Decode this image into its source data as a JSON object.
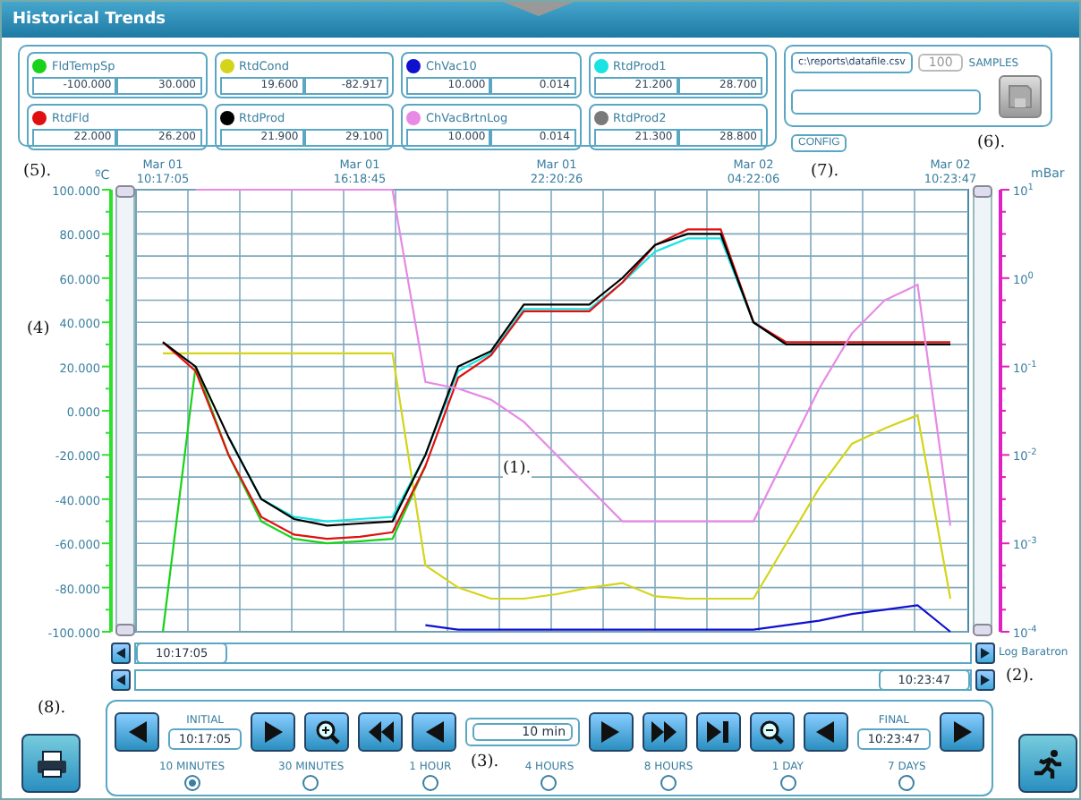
{
  "window": {
    "title": "Historical Trends"
  },
  "legend": [
    {
      "name": "FldTempSp",
      "color": "#19d219",
      "min": "-100.000",
      "max": "30.000"
    },
    {
      "name": "RtdCond",
      "color": "#d4d41a",
      "min": "19.600",
      "max": "-82.917"
    },
    {
      "name": "ChVac10",
      "color": "#1010d0",
      "min": "10.000",
      "max": "0.014"
    },
    {
      "name": "RtdProd1",
      "color": "#19e3e3",
      "min": "21.200",
      "max": "28.700"
    },
    {
      "name": "RtdFld",
      "color": "#e01010",
      "min": "22.000",
      "max": "26.200"
    },
    {
      "name": "RtdProd",
      "color": "#000000",
      "min": "21.900",
      "max": "29.100"
    },
    {
      "name": "ChVacBrtnLog",
      "color": "#e68ae6",
      "min": "10.000",
      "max": "0.014"
    },
    {
      "name": "RtdProd2",
      "color": "#7a7a7a",
      "min": "21.300",
      "max": "28.800"
    }
  ],
  "file_panel": {
    "path": "c:\\reports\\datafile.csv",
    "samples": {
      "value": "100",
      "label": "SAMPLES",
      "disabled": true
    },
    "save_button": {
      "disabled": true
    }
  },
  "config_button": "CONFIG",
  "annotations": [
    "(5).",
    "(7).",
    "(6).",
    "(4)",
    "(1).",
    "(2).",
    "(3).",
    "(8)."
  ],
  "chart": {
    "left_unit": "ºC",
    "right_unit": "mBar",
    "right_axis_name": "Log Baratron",
    "right_ticks": [
      {
        "base": "10",
        "exponent": "1"
      },
      {
        "base": "10",
        "exponent": "0"
      },
      {
        "base": "10",
        "exponent": "-1"
      },
      {
        "base": "10",
        "exponent": "-2"
      },
      {
        "base": "10",
        "exponent": "-3"
      },
      {
        "base": "10",
        "exponent": "-4"
      }
    ],
    "chart_data": {
      "type": "line",
      "categories": [
        "Mar 01 10:17:05",
        null,
        null,
        null,
        null,
        null,
        "Mar 01 16:18:45",
        null,
        null,
        null,
        null,
        null,
        "Mar 01 22:20:26",
        null,
        null,
        null,
        null,
        null,
        "Mar 02 04:22:06",
        null,
        null,
        null,
        null,
        null,
        "Mar 02 10:23:47"
      ],
      "ylim": [
        -100,
        100
      ],
      "grid": true,
      "yticks": [
        {
          "value": 100,
          "label": "100.000"
        },
        {
          "value": 80,
          "label": "80.000"
        },
        {
          "value": 60,
          "label": "60.000"
        },
        {
          "value": 40,
          "label": "40.000"
        },
        {
          "value": 20,
          "label": "20.000"
        },
        {
          "value": 0,
          "label": "0.000"
        },
        {
          "value": -20,
          "label": "-20.000"
        },
        {
          "value": -40,
          "label": "-40.000"
        },
        {
          "value": -60,
          "label": "-60.000"
        },
        {
          "value": -80,
          "label": "-80.000"
        },
        {
          "value": -100,
          "label": "-100.000"
        }
      ],
      "series": [
        {
          "color": "#19d219",
          "values": [
            -100,
            20,
            -20,
            -50,
            -58,
            -60,
            -59,
            -58,
            -25,
            null,
            null,
            null,
            null,
            null,
            null,
            null,
            null,
            null,
            null,
            null,
            null,
            null,
            null,
            null,
            null
          ]
        },
        {
          "color": "#d4d41a",
          "values": [
            26,
            26,
            26,
            26,
            26,
            26,
            26,
            26,
            -70,
            -80,
            -85,
            -85,
            -83,
            -80,
            -78,
            -84,
            -85,
            -85,
            -85,
            -60,
            -35,
            -15,
            -8,
            -2,
            -85
          ]
        },
        {
          "color": "#1010d0",
          "values": [
            null,
            null,
            null,
            null,
            null,
            null,
            null,
            null,
            -97,
            -99,
            -99,
            -99,
            -99,
            -99,
            -99,
            -99,
            -99,
            -99,
            -99,
            -97,
            -95,
            -92,
            -90,
            -88,
            -100
          ]
        },
        {
          "color": "#19e3e3",
          "values": [
            null,
            null,
            -12,
            -40,
            -48,
            -50,
            -49,
            -48,
            -20,
            18,
            26,
            46,
            46,
            46,
            58,
            72,
            78,
            78,
            40,
            30,
            null,
            null,
            null,
            null,
            null
          ]
        },
        {
          "color": "#e01010",
          "values": [
            31,
            18,
            -20,
            -48,
            -56,
            -58,
            -57,
            -55,
            -25,
            15,
            25,
            45,
            45,
            45,
            58,
            75,
            82,
            82,
            40,
            31,
            31,
            31,
            31,
            31,
            31
          ]
        },
        {
          "color": "#000000",
          "values": [
            31,
            20,
            -12,
            -40,
            -49,
            -52,
            -51,
            -50,
            -20,
            20,
            27,
            48,
            48,
            48,
            60,
            75,
            80,
            80,
            40,
            30,
            30,
            30,
            30,
            30,
            30
          ]
        },
        {
          "color": "#e68ae6",
          "values": [
            null,
            100,
            100,
            100,
            100,
            100,
            100,
            100,
            13,
            10,
            5,
            -5,
            -20,
            -35,
            -50,
            -50,
            -50,
            -50,
            -50,
            -20,
            10,
            35,
            50,
            57,
            -52
          ]
        }
      ]
    }
  },
  "scroll": {
    "start": "10:17:05",
    "end": "10:23:47"
  },
  "controls": {
    "initial": {
      "label": "INITIAL",
      "value": "10:17:05"
    },
    "span": "10 min",
    "final": {
      "label": "FINAL",
      "value": "10:23:47"
    },
    "ranges": [
      {
        "label": "10 MINUTES",
        "selected": true
      },
      {
        "label": "30 MINUTES",
        "selected": false
      },
      {
        "label": "1 HOUR",
        "selected": false
      },
      {
        "label": "4 HOURS",
        "selected": false
      },
      {
        "label": "8 HOURS",
        "selected": false
      },
      {
        "label": "1 DAY",
        "selected": false
      },
      {
        "label": "7 DAYS",
        "selected": false
      }
    ]
  }
}
